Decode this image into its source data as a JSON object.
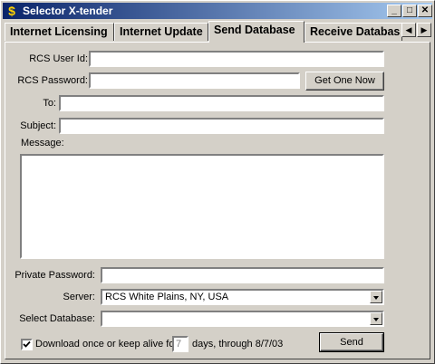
{
  "window": {
    "title": "Selector X-tender",
    "minimize": "_",
    "maximize": "□",
    "close": "✕"
  },
  "tabs": [
    {
      "label": "Internet Licensing"
    },
    {
      "label": "Internet Update"
    },
    {
      "label": "Send Database",
      "active": true
    },
    {
      "label": "Receive Databas"
    }
  ],
  "tab_scroll": {
    "left": "◀",
    "right": "▶"
  },
  "form": {
    "user_id_label": "RCS User Id:",
    "user_id_value": "",
    "password_label": "RCS Password:",
    "password_value": "",
    "get_one_now_label": "Get One Now",
    "to_label": "To:",
    "to_value": "",
    "subject_label": "Subject:",
    "subject_value": "",
    "message_label": "Message:",
    "message_value": "",
    "private_password_label": "Private Password:",
    "private_password_value": "",
    "server_label": "Server:",
    "server_value": "RCS White Plains, NY, USA",
    "select_database_label": "Select Database:",
    "select_database_value": "",
    "download_label": "Download once or keep alive for",
    "download_checked": true,
    "days_value": "7",
    "days_suffix": "days, through 8/7/03",
    "send_label": "Send"
  }
}
